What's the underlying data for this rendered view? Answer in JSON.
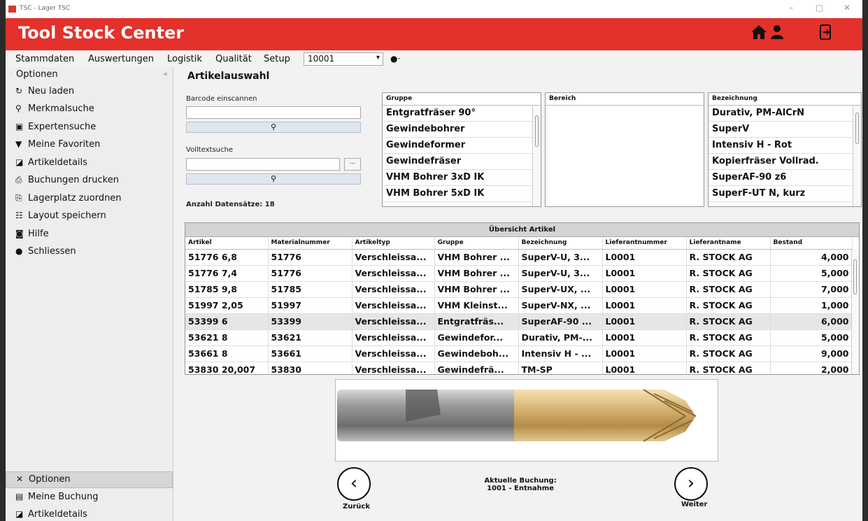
{
  "window": {
    "title": "TSC - Lager TSC",
    "controls": [
      "–",
      "▢",
      "✕"
    ]
  },
  "header": {
    "app_title": "Tool Stock Center",
    "icons": [
      "home-icon",
      "user-icon",
      "logout-icon"
    ],
    "color": "#e4312b"
  },
  "menu": {
    "items": [
      "Stammdaten",
      "Auswertungen",
      "Logistik",
      "Qualität",
      "Setup"
    ],
    "combo_value": "10001",
    "combo_arrow": "▾",
    "extra": "●·"
  },
  "sidebar": {
    "header": "Optionen",
    "collapse": "«",
    "items": [
      {
        "icon": "reload-icon",
        "glyph": "↻",
        "label": "Neu laden"
      },
      {
        "icon": "search-icon",
        "glyph": "⚲",
        "label": "Merkmalsuche"
      },
      {
        "icon": "expert-search-icon",
        "glyph": "▣",
        "label": "Expertensuche"
      },
      {
        "icon": "filter-icon",
        "glyph": "▼",
        "label": "Meine Favoriten"
      },
      {
        "icon": "article-details-icon",
        "glyph": "◪",
        "label": "Artikeldetails"
      },
      {
        "icon": "printer-icon",
        "glyph": "⎙",
        "label": "Buchungen drucken"
      },
      {
        "icon": "storage-assign-icon",
        "glyph": "⎘",
        "label": "Lagerplatz zuordnen"
      },
      {
        "icon": "layout-save-icon",
        "glyph": "☷",
        "label": "Layout speichern"
      },
      {
        "icon": "help-icon",
        "glyph": "◙",
        "label": "Hilfe"
      },
      {
        "icon": "close-circle-icon",
        "glyph": "●",
        "label": "Schliessen"
      }
    ],
    "bottom": [
      {
        "icon": "options-tools-icon",
        "glyph": "✕",
        "label": "Optionen"
      },
      {
        "icon": "my-booking-icon",
        "glyph": "▤",
        "label": "Meine Buchung"
      },
      {
        "icon": "article-details-icon",
        "glyph": "◪",
        "label": "Artikeldetails"
      }
    ]
  },
  "main": {
    "title": "Artikelauswahl",
    "barcode_label": "Barcode einscannen",
    "barcode_value": "",
    "fulltext_label": "Volltextsuche",
    "fulltext_value": "",
    "search_glyph": "⚲",
    "ellipsis": "...",
    "count": "Anzahl Datensätze: 18"
  },
  "lists": {
    "gruppe": {
      "header": "Gruppe",
      "items": [
        "Entgratfräser 90°",
        "Gewindebohrer",
        "Gewindeformer",
        "Gewindefräser",
        "VHM Bohrer 3xD IK",
        "VHM Bohrer 5xD IK"
      ]
    },
    "bereich": {
      "header": "Bereich",
      "items": []
    },
    "bezeichnung": {
      "header": "Bezeichnung",
      "items": [
        "Durativ, PM-AlCrN",
        "SuperV",
        "Intensiv H - Rot",
        "Kopierfräser Vollrad.",
        "SuperAF-90 z6",
        "SuperF-UT N, kurz"
      ]
    }
  },
  "grid": {
    "caption": "Übersicht Artikel",
    "columns": [
      "Artikel",
      "Materialnummer",
      "Artikeltyp",
      "Gruppe",
      "Bezeichnung",
      "Lieferantnummer",
      "Lieferantname",
      "Bestand"
    ],
    "rows": [
      [
        "51776 6,8",
        "51776",
        "Verschleissa...",
        "VHM Bohrer ...",
        "SuperV-U, 3...",
        "L0001",
        "R. STOCK AG",
        "4,000"
      ],
      [
        "51776 7,4",
        "51776",
        "Verschleissa...",
        "VHM Bohrer ...",
        "SuperV-U, 3...",
        "L0001",
        "R. STOCK AG",
        "5,000"
      ],
      [
        "51785 9,8",
        "51785",
        "Verschleissa...",
        "VHM Bohrer ...",
        "SuperV-UX, ...",
        "L0001",
        "R. STOCK AG",
        "7,000"
      ],
      [
        "51997 2,05",
        "51997",
        "Verschleissa...",
        "VHM Kleinst...",
        "SuperV-NX, ...",
        "L0001",
        "R. STOCK AG",
        "1,000"
      ],
      [
        "53399 6",
        "53399",
        "Verschleissa...",
        "Entgratfräs...",
        "SuperAF-90 ...",
        "L0001",
        "R. STOCK AG",
        "6,000"
      ],
      [
        "53621 8",
        "53621",
        "Verschleissa...",
        "Gewindefor...",
        "Durativ, PM-...",
        "L0001",
        "R. STOCK AG",
        "5,000"
      ],
      [
        "53661 8",
        "53661",
        "Verschleissa...",
        "Gewindeboh...",
        "Intensiv H - ...",
        "L0001",
        "R. STOCK AG",
        "9,000"
      ],
      [
        "53830 20,007",
        "53830",
        "Verschleissa...",
        "Gewindefrä...",
        "TM-SP",
        "L0001",
        "R. STOCK AG",
        "2,000"
      ]
    ],
    "highlighted_row": 4
  },
  "footer": {
    "back_glyph": "‹",
    "back_label": "Zurück",
    "next_glyph": "›",
    "next_label": "Weiter",
    "booking_title": "Aktuelle Buchung:",
    "booking_value": "1001 - Entnahme"
  }
}
